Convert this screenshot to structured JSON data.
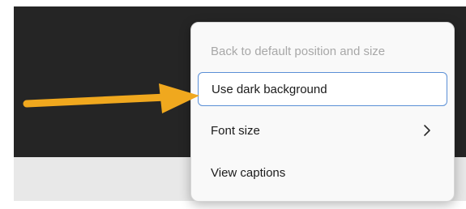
{
  "menu": {
    "items": [
      {
        "label": "Back to default position and size",
        "disabled": true
      },
      {
        "label": "Use dark background",
        "highlighted": true
      },
      {
        "label": "Font size",
        "has_submenu": true,
        "submenu_icon": "chevron-right-icon"
      },
      {
        "label": "View captions"
      }
    ]
  },
  "colors": {
    "background_dark": "#252525",
    "menu_background": "#f9f9f9",
    "highlight_border": "#5a8fd6",
    "annotation_arrow": "#f0a81e",
    "disabled_text": "#a8a8a8"
  },
  "annotation": {
    "icon": "arrow-right-annotation"
  }
}
